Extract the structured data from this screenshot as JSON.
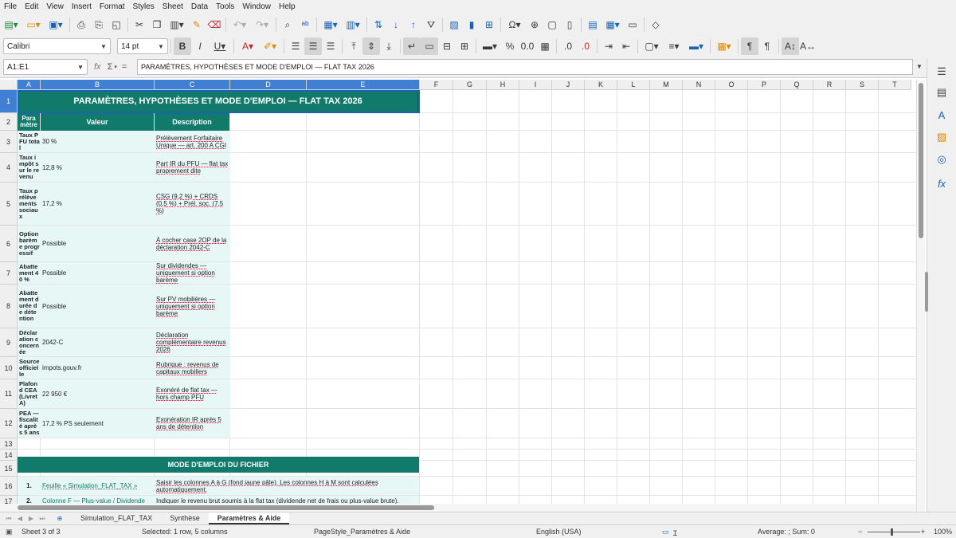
{
  "menu": [
    "File",
    "Edit",
    "View",
    "Insert",
    "Format",
    "Styles",
    "Sheet",
    "Data",
    "Tools",
    "Window",
    "Help"
  ],
  "toolbar": {
    "font_name": "Calibri",
    "font_size": "14 pt"
  },
  "formula_bar": {
    "name_box": "A1:E1",
    "fx_symbol": "fx",
    "sum_symbol": "Σ",
    "equals_symbol": "=",
    "content": "PARAMÈTRES, HYPOTHÈSES ET MODE D'EMPLOI — FLAT TAX 2026"
  },
  "columns": [
    "A",
    "B",
    "C",
    "D",
    "E",
    "F",
    "G",
    "H",
    "I",
    "J",
    "K",
    "L",
    "M",
    "N",
    "O",
    "P",
    "Q",
    "R",
    "S",
    "T"
  ],
  "row_numbers": [
    "1",
    "2",
    "3",
    "4",
    "5",
    "6",
    "7",
    "8",
    "9",
    "10",
    "11",
    "12",
    "13",
    "14",
    "15",
    "16",
    "17"
  ],
  "sheet": {
    "title": "PARAMÈTRES, HYPOTHÈSES ET MODE D'EMPLOI — FLAT TAX 2026",
    "headers": {
      "param": "Para mètre",
      "value": "Valeur",
      "description": "Description"
    },
    "rows": [
      {
        "param": "Taux PFU total",
        "value": "30 %",
        "description": "Prélèvement Forfaitaire Unique — art. 200 A CGI"
      },
      {
        "param": "Taux impôt sur le revenu",
        "value": "12,8 %",
        "description": "Part IR du PFU — flat tax proprement dite"
      },
      {
        "param": "Taux prélèvements sociaux",
        "value": "17,2 %",
        "description": "CSG (9,2 %) + CRDS (0,5 %) + Prél. soc. (7,5 %)"
      },
      {
        "param": "Option barème progressif",
        "value": "Possible",
        "description": "À cocher case 2OP de la déclaration 2042-C"
      },
      {
        "param": "Abattement 40 %",
        "value": "Possible",
        "description": "Sur dividendes — uniquement si option barème"
      },
      {
        "param": "Abattement durée de détention",
        "value": "Possible",
        "description": "Sur PV mobilières — uniquement si option barème"
      },
      {
        "param": "Déclaration concernée",
        "value": "2042-C",
        "description": "Déclaration complémentaire revenus 2026"
      },
      {
        "param": "Source officielle",
        "value": "impots.gouv.fr",
        "description": "Rubrique : revenus de capitaux mobiliers"
      },
      {
        "param": "Plafond CEA (Livret A)",
        "value": "22 950 €",
        "description": "Exonéré de flat tax — hors champ PFU"
      },
      {
        "param": "PEA — fiscalité après 5 ans",
        "value": "17,2 % PS seulement",
        "description": "Exonération IR après 5 ans de détention"
      }
    ],
    "mode_header": "MODE D'EMPLOI DU FICHIER",
    "steps": [
      {
        "num": "1.",
        "label": "Feuille « Simulation_FLAT_TAX »",
        "text": "Saisir les colonnes A à G (fond jaune pâle). Les colonnes H à M sont calculées automatiquement."
      },
      {
        "num": "2.",
        "label": "Colonne F — Plus-value / Dividende",
        "text": "Indiquer le revenu brut soumis à la flat tax (dividende net de frais ou plus-value brute)."
      }
    ]
  },
  "sheet_tabs": [
    "Simulation_FLAT_TAX",
    "Synthèse",
    "Paramètres & Aide"
  ],
  "active_tab": 2,
  "status": {
    "sheet": "Sheet 3 of 3",
    "selection": "Selected: 1 row, 5 columns",
    "page_style": "PageStyle_Paramètres & Aide",
    "language": "English (USA)",
    "summary": "Average: ; Sum: 0",
    "zoom": "100%"
  },
  "colors": {
    "header_green": "#127a6b",
    "band_fill": "#e6f7f5",
    "selection_blue": "#1a62b8"
  },
  "icons": {
    "sidebar": [
      "hamburger-icon",
      "properties-icon",
      "styles-icon",
      "gallery-icon",
      "navigator-icon",
      "functions-icon"
    ]
  }
}
